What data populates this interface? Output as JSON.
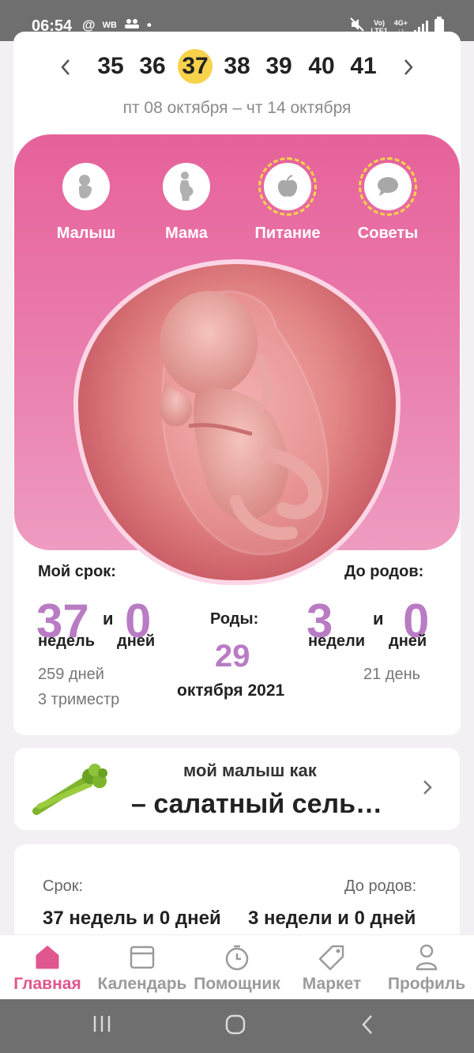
{
  "status_bar": {
    "time": "06:54",
    "left_icons": [
      "@",
      "WB",
      "group-icon",
      "•"
    ],
    "carrier_top": "Vo)",
    "carrier_bottom": "LTE1",
    "net_top": "4G+",
    "net_bottom": "↓↑"
  },
  "week_nav": {
    "weeks": [
      "35",
      "36",
      "37",
      "38",
      "39",
      "40",
      "41"
    ],
    "active_week": "37",
    "date_range": "пт 08 октября – чт 14 октября"
  },
  "categories": [
    {
      "label": "Малыш",
      "icon": "baby-icon"
    },
    {
      "label": "Мама",
      "icon": "pregnant-mom-icon"
    },
    {
      "label": "Питание",
      "icon": "apple-icon"
    },
    {
      "label": "Советы",
      "icon": "chat-bubble-icon"
    }
  ],
  "term": {
    "my_term_label": "Мой срок:",
    "weeks_num": "37",
    "and1": "и",
    "days_num": "0",
    "weeks_unit": "недель",
    "days_unit": "дней",
    "total_days": "259 дней",
    "trimester": "3 триместр"
  },
  "birth": {
    "label": "Роды:",
    "day": "29",
    "month_year": "октября 2021"
  },
  "until": {
    "label": "До родов:",
    "weeks_num": "3",
    "and": "и",
    "days_num": "0",
    "weeks_unit": "недели",
    "days_unit": "дней",
    "total_days": "21 день"
  },
  "size_card": {
    "top": "мой малыш как",
    "main": "– салатный сель…"
  },
  "summary": {
    "term_label": "Срок:",
    "term_value": "37 недель и 0 дней",
    "until_label": "До родов:",
    "until_value": "3 недели и 0 дней"
  },
  "bottom_nav": [
    {
      "label": "Главная",
      "icon": "home-icon",
      "active": true
    },
    {
      "label": "Календарь",
      "icon": "calendar-icon",
      "active": false
    },
    {
      "label": "Помощник",
      "icon": "stopwatch-icon",
      "active": false
    },
    {
      "label": "Маркет",
      "icon": "tag-icon",
      "active": false
    },
    {
      "label": "Профиль",
      "icon": "profile-icon",
      "active": false
    }
  ],
  "colors": {
    "accent_pink": "#e0568e",
    "week_highlight": "#f7d24b",
    "number_purple": "#b97cc4"
  }
}
